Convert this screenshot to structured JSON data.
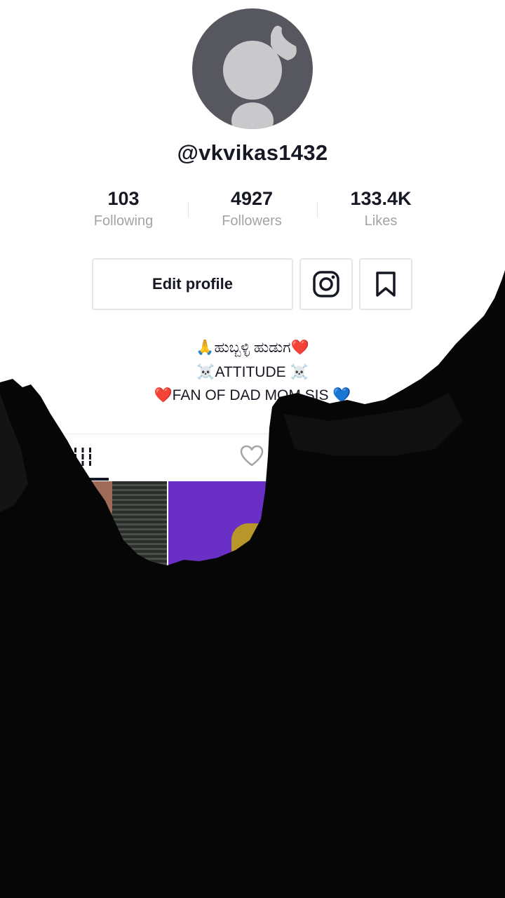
{
  "profile": {
    "username": "@vkvikas1432"
  },
  "stats": [
    {
      "value": "103",
      "label": "Following"
    },
    {
      "value": "4927",
      "label": "Followers"
    },
    {
      "value": "133.4K",
      "label": "Likes"
    }
  ],
  "actions": {
    "edit_profile_label": "Edit profile",
    "instagram_icon": "instagram-icon",
    "bookmark_icon": "bookmark-icon"
  },
  "bio": {
    "line1": "🙏ಹುಬ್ಬಳ್ಳಿ ಹುಡುಗ❤️",
    "line2": "☠️ATTITUDE ☠️",
    "line3": "❤️FAN OF DAD MOM SIS 💙"
  },
  "tabs": [
    {
      "icon": "grid-icon",
      "active": true
    },
    {
      "icon": "heart-icon",
      "active": false
    }
  ],
  "colors": {
    "text": "#161823",
    "secondary_text": "#a3a3a8",
    "border": "#e6e6e8",
    "avatar_bg": "#57575f",
    "video_purple": "#6a2fc4"
  }
}
